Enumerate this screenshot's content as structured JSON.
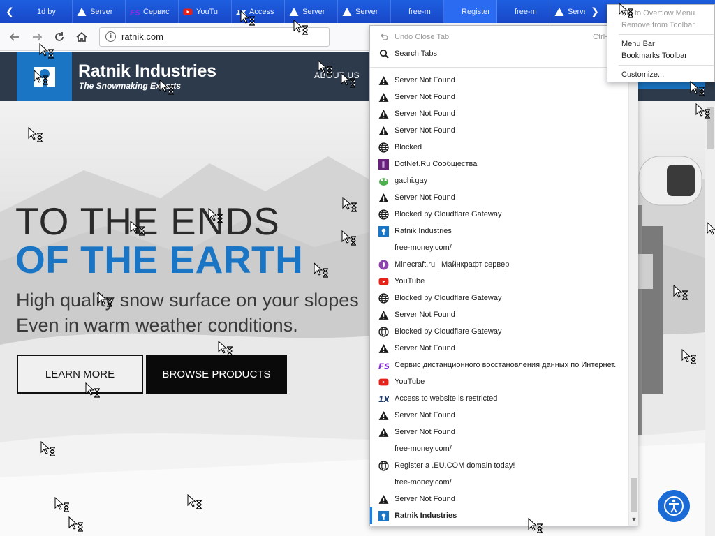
{
  "tabstrip": {
    "scroll_left_icon": "chevron-left-icon",
    "scroll_right_icon": "chevron-right-icon",
    "new_tab_icon": "plus-icon",
    "tabs": [
      {
        "label": "1d by",
        "icon": "none",
        "active": false
      },
      {
        "label": "Server",
        "icon": "warning-icon",
        "active": false
      },
      {
        "label": "Сервис",
        "icon": "fs-icon",
        "active": false
      },
      {
        "label": "YouTu",
        "icon": "youtube-icon",
        "active": false
      },
      {
        "label": "Access",
        "icon": "1x-icon",
        "active": false
      },
      {
        "label": "Server",
        "icon": "warning-icon",
        "active": false
      },
      {
        "label": "Server",
        "icon": "warning-icon",
        "active": false
      },
      {
        "label": "free-m",
        "icon": "none",
        "active": false
      },
      {
        "label": "Register a",
        "icon": "none",
        "active": true
      },
      {
        "label": "free-m",
        "icon": "none",
        "active": false
      },
      {
        "label": "Server",
        "icon": "warning-icon",
        "active": false
      }
    ]
  },
  "navbar": {
    "url": "ratnik.com"
  },
  "site": {
    "brand_name": "Ratnik Industries",
    "tagline": "The Snowmaking Experts",
    "nav_about": "ABOUT US",
    "hero_line1": "TO THE ENDS",
    "hero_line2": "OF THE EARTH",
    "hero_sub1": "High quality snow surface on your slopes",
    "hero_sub2": "Even in warm weather conditions.",
    "learn_more": "LEARN MORE",
    "browse_products": "BROWSE PRODUCTS",
    "colors": {
      "brand_blue": "#1a76c5",
      "header_dark": "#2c3a4c"
    }
  },
  "tabs_menu": {
    "undo_close_tab": "Undo Close Tab",
    "undo_shortcut": "Ctrl+S",
    "search_tabs": "Search Tabs",
    "items": [
      {
        "label": "Server Not Found",
        "icon": "warning-icon"
      },
      {
        "label": "Server Not Found",
        "icon": "warning-icon"
      },
      {
        "label": "Server Not Found",
        "icon": "warning-icon"
      },
      {
        "label": "Server Not Found",
        "icon": "warning-icon"
      },
      {
        "label": "Blocked",
        "icon": "globe-icon"
      },
      {
        "label": "DotNet.Ru Сообщества",
        "icon": "dotnet-icon"
      },
      {
        "label": "gachi.gay",
        "icon": "frog-icon"
      },
      {
        "label": "Server Not Found",
        "icon": "warning-icon"
      },
      {
        "label": "Blocked by Cloudflare Gateway",
        "icon": "globe-icon"
      },
      {
        "label": "Ratnik Industries",
        "icon": "ratnik-icon"
      },
      {
        "label": "free-money.com/",
        "icon": "none"
      },
      {
        "label": "Minecraft.ru | Майнкрафт сервер",
        "icon": "minecraft-icon"
      },
      {
        "label": "YouTube",
        "icon": "youtube-icon"
      },
      {
        "label": "Blocked by Cloudflare Gateway",
        "icon": "globe-icon"
      },
      {
        "label": "Server Not Found",
        "icon": "warning-icon"
      },
      {
        "label": "Blocked by Cloudflare Gateway",
        "icon": "globe-icon"
      },
      {
        "label": "Server Not Found",
        "icon": "warning-icon"
      },
      {
        "label": "Сервис дистанционного восстановления данных по Интернет.",
        "icon": "fs-icon"
      },
      {
        "label": "YouTube",
        "icon": "youtube-icon"
      },
      {
        "label": "Access to website is restricted",
        "icon": "1x-icon"
      },
      {
        "label": "Server Not Found",
        "icon": "warning-icon"
      },
      {
        "label": "Server Not Found",
        "icon": "warning-icon"
      },
      {
        "label": "free-money.com/",
        "icon": "none"
      },
      {
        "label": "Register a .EU.COM domain today!",
        "icon": "globe-icon"
      },
      {
        "label": "free-money.com/",
        "icon": "none"
      },
      {
        "label": "Server Not Found",
        "icon": "warning-icon"
      },
      {
        "label": "Ratnik Industries",
        "icon": "ratnik-icon",
        "selected": true
      }
    ]
  },
  "context_menu": {
    "pin_to_overflow": "Pin to Overflow Menu",
    "remove_from_toolbar": "Remove from Toolbar",
    "menu_bar": "Menu Bar",
    "bookmarks_toolbar": "Bookmarks Toolbar",
    "customize": "Customize..."
  },
  "cursor_icon": "busy-cursor-icon"
}
